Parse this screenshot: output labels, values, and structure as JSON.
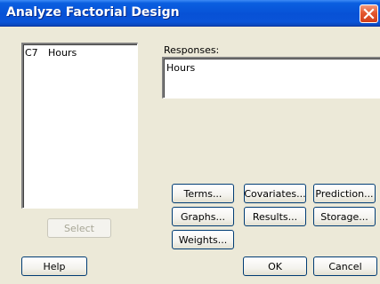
{
  "window": {
    "title": "Analyze Factorial Design"
  },
  "variables": {
    "column": "C7",
    "name": "Hours"
  },
  "responses": {
    "label": "Responses:",
    "value": "Hours"
  },
  "buttons": {
    "terms": "Terms...",
    "covariates": "Covariates...",
    "prediction": "Prediction...",
    "graphs": "Graphs...",
    "results": "Results...",
    "storage": "Storage...",
    "weights": "Weights...",
    "select": "Select",
    "help": "Help",
    "ok": "OK",
    "cancel": "Cancel"
  },
  "colors": {
    "titlebar": "#0751d6",
    "dialog": "#ece9d8",
    "close": "#e4572f"
  },
  "icons": {
    "close": "close-icon"
  }
}
